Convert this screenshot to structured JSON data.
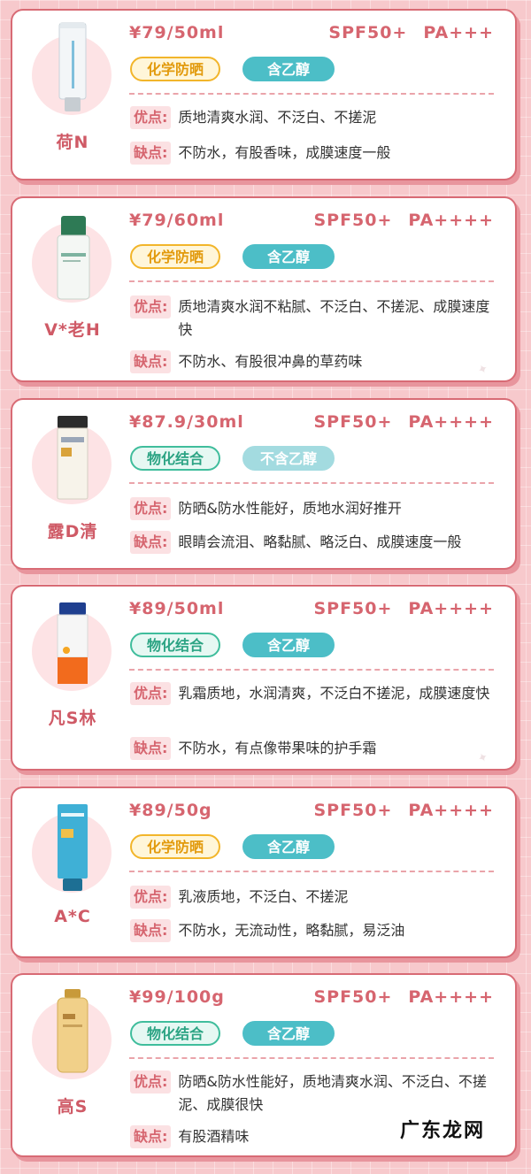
{
  "labels": {
    "pros": "优点:",
    "cons": "缺点:"
  },
  "products": [
    {
      "name": "荷N",
      "price": "¥79/50ml",
      "spf": "SPF50+",
      "pa": "PA+++",
      "type_tag": "化学防晒",
      "type_kind": "chemical",
      "alcohol_tag": "含乙醇",
      "alcohol_kind": "has",
      "pros": "质地清爽水润、不泛白、不搓泥",
      "cons": "不防水，有股香味，成膜速度一般"
    },
    {
      "name": "V*老H",
      "price": "¥79/60ml",
      "spf": "SPF50+",
      "pa": "PA++++",
      "type_tag": "化学防晒",
      "type_kind": "chemical",
      "alcohol_tag": "含乙醇",
      "alcohol_kind": "has",
      "pros": "质地清爽水润不粘腻、不泛白、不搓泥、成膜速度快",
      "cons": "不防水、有股很冲鼻的草药味"
    },
    {
      "name": "露D清",
      "price": "¥87.9/30ml",
      "spf": "SPF50+",
      "pa": "PA++++",
      "type_tag": "物化结合",
      "type_kind": "physical",
      "alcohol_tag": "不含乙醇",
      "alcohol_kind": "none",
      "pros": "防晒&防水性能好，质地水润好推开",
      "cons": "眼睛会流泪、略黏腻、略泛白、成膜速度一般"
    },
    {
      "name": "凡S林",
      "price": "¥89/50ml",
      "spf": "SPF50+",
      "pa": "PA++++",
      "type_tag": "物化结合",
      "type_kind": "physical",
      "alcohol_tag": "含乙醇",
      "alcohol_kind": "has",
      "pros": "乳霜质地，水润清爽，不泛白不搓泥，成膜速度快",
      "cons": "不防水，有点像带果味的护手霜"
    },
    {
      "name": "A*C",
      "price": "¥89/50g",
      "spf": "SPF50+",
      "pa": "PA++++",
      "type_tag": "化学防晒",
      "type_kind": "chemical",
      "alcohol_tag": "含乙醇",
      "alcohol_kind": "has",
      "pros": "乳液质地，不泛白、不搓泥",
      "cons": "不防水，无流动性，略黏腻，易泛油"
    },
    {
      "name": "高S",
      "price": "¥99/100g",
      "spf": "SPF50+",
      "pa": "PA++++",
      "type_tag": "物化结合",
      "type_kind": "physical",
      "alcohol_tag": "含乙醇",
      "alcohol_kind": "has",
      "pros": "防晒&防水性能好，质地清爽水润、不泛白、不搓泥、成膜很快",
      "cons": "有股酒精味"
    }
  ],
  "site_watermark": "广东龙网",
  "colors": {
    "accent": "#d6656f",
    "chemical_tag": "#f2b52a",
    "physical_tag": "#3fbd9c",
    "alcohol_tag": "#4cbec7",
    "no_alcohol_tag": "#a3dbe0",
    "background": "#f7c9cc"
  }
}
